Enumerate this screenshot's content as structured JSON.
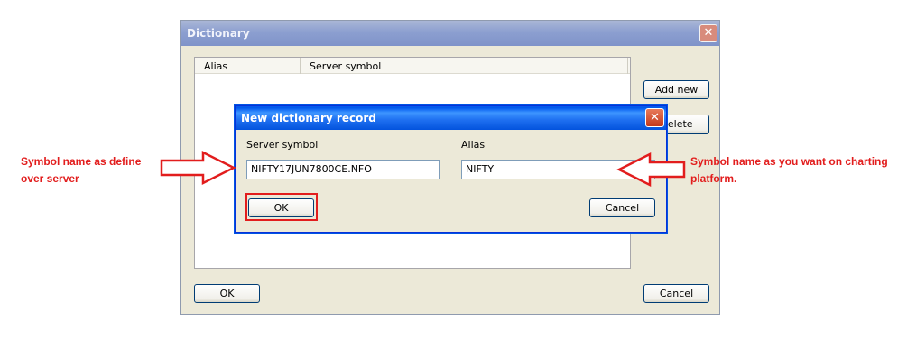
{
  "outer_window": {
    "title": "Dictionary",
    "close_glyph": "✕",
    "columns": [
      "Alias",
      "Server symbol"
    ],
    "add_new_label": "Add new",
    "delete_label": "Delete",
    "ok_label": "OK",
    "cancel_label": "Cancel"
  },
  "dialog": {
    "title": "New dictionary record",
    "close_glyph": "✕",
    "server_symbol_label": "Server symbol",
    "server_symbol_value": "NIFTY17JUN7800CE.NFO",
    "alias_label": "Alias",
    "alias_value": "NIFTY",
    "ok_label": "OK",
    "cancel_label": "Cancel"
  },
  "annotations": {
    "left_line1": "Symbol name as define",
    "left_line2": "over server",
    "right_line1": "Symbol name as you want on charting",
    "right_line2": "platform.",
    "color": "#e21d1d"
  }
}
